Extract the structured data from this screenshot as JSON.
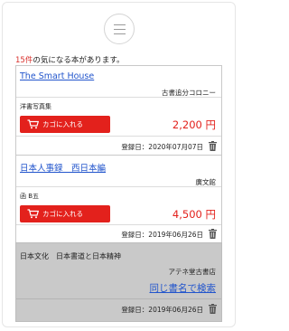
{
  "header": {
    "menu_icon": "hamburger-icon"
  },
  "summary": {
    "count": "15件",
    "text": "の気になる本があります。"
  },
  "books": [
    {
      "title": "The Smart House",
      "seller": "古書追分コロニー",
      "condition": "洋書写真集",
      "cart_label": "カゴに入れる",
      "price": "2,200 円",
      "registered": "登録日：2020年07月07日"
    },
    {
      "title": "日本人事録　西日本編",
      "seller": "廣文館",
      "condition": "函 B五",
      "cart_label": "カゴに入れる",
      "price": "4,500 円",
      "registered": "登録日：2019年06月26日"
    },
    {
      "title": "日本文化　日本書道と日本精神",
      "seller": "アテネ堂古書店",
      "search_label": "同じ書名で検索",
      "registered": "登録日：2019年06月26日"
    }
  ],
  "colors": {
    "accent": "#e3211c",
    "link": "#2255cc",
    "count": "#d9302c",
    "soldout_bg": "#c9c9c9"
  }
}
